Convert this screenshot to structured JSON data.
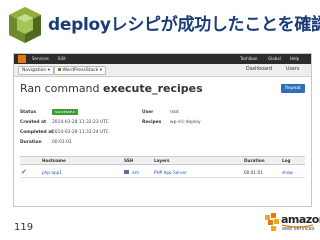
{
  "slide": {
    "title": "deployレシピが成功したことを確認",
    "page_number": "119",
    "brand_colors": {
      "title": "#1a3c78",
      "aws_orange": "#e47911",
      "success": "#3a9a33"
    }
  },
  "aws_bar": {
    "services": "Services",
    "edit": "Edit",
    "user": "Toshiban",
    "region": "Global",
    "help": "Help"
  },
  "opsworks_bar": {
    "navigation": "Navigation",
    "stack": "WordPressStack",
    "dashboard": "Dashboard",
    "users": "Users"
  },
  "run": {
    "title_prefix": "Ran command",
    "command": "execute_recipes",
    "repeat_label": "Repeat",
    "fields": {
      "status_label": "Status",
      "status_value": "successful",
      "created_label": "Created at",
      "created_value": "2014-03-28 11:32:23 UTC",
      "completed_label": "Completed at",
      "completed_value": "2014-03-28 11:33:24 UTC",
      "duration_label": "Duration",
      "duration_value": "00:01:01",
      "user_label": "User",
      "user_value": "root",
      "recipes_label": "Recipes",
      "recipes_value": "wp-cli::deploy"
    }
  },
  "instances_table": {
    "headers": {
      "hostname": "Hostname",
      "ssh": "SSH",
      "layers": "Layers",
      "duration": "Duration",
      "log": "Log"
    },
    "rows": [
      {
        "hostname": "php-app1",
        "ssh": "ssh",
        "layers": "PHP App Server",
        "duration": "00:01:01",
        "log": "show"
      }
    ]
  },
  "amazon_logo": {
    "wordmark": "amazon",
    "sub": "web services"
  }
}
